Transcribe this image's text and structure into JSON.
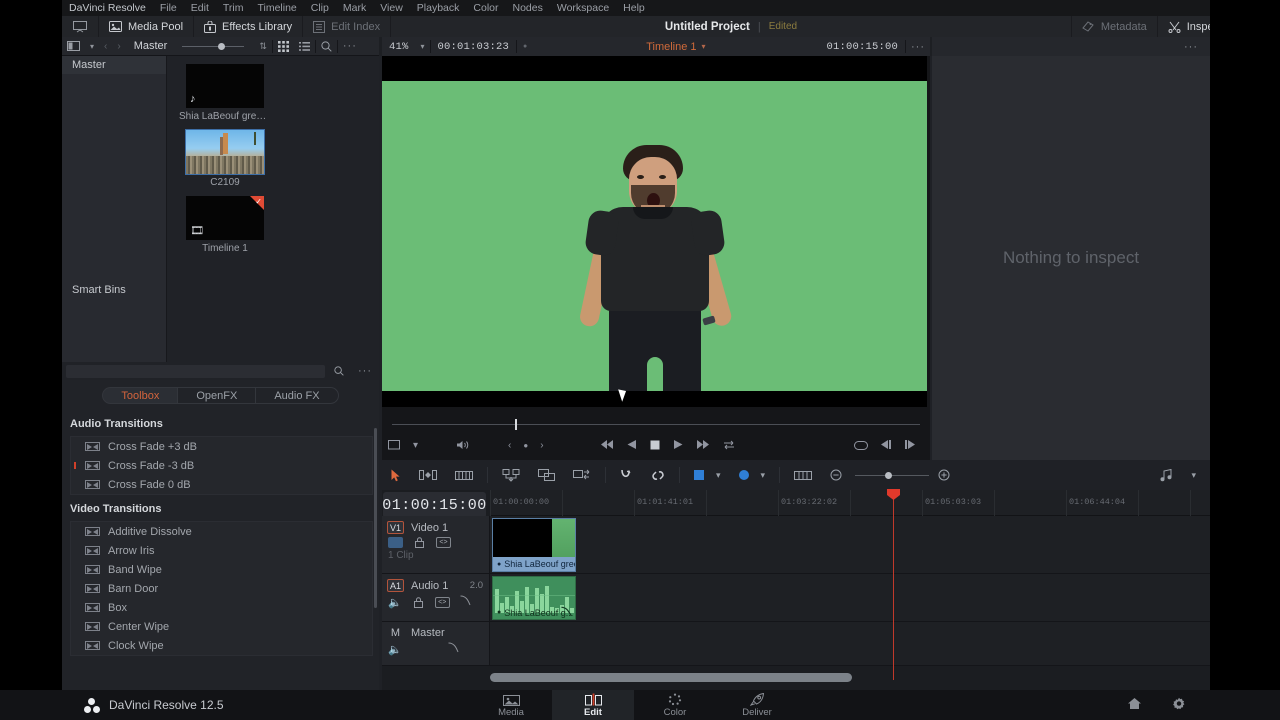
{
  "menu": {
    "app": "DaVinci Resolve",
    "items": [
      "File",
      "Edit",
      "Trim",
      "Timeline",
      "Clip",
      "Mark",
      "View",
      "Playback",
      "Color",
      "Nodes",
      "Workspace",
      "Help"
    ]
  },
  "toolbar": {
    "media_pool": "Media Pool",
    "effects_library": "Effects Library",
    "edit_index": "Edit Index",
    "project_title": "Untitled Project",
    "project_status": "Edited",
    "metadata": "Metadata",
    "inspector": "Inspector"
  },
  "pool_header": {
    "bin_name": "Master",
    "zoom": "41%"
  },
  "media_pool": {
    "bins": [
      "Master",
      "Smart Bins"
    ],
    "selected_bin": "Master",
    "items": [
      {
        "name": "Shia LaBeouf green s...",
        "icon": "music-note-icon",
        "kind": "audio"
      },
      {
        "name": "C2109",
        "icon": "thumbnail-icon",
        "kind": "video"
      },
      {
        "name": "Timeline 1",
        "icon": "film-strip-icon",
        "kind": "timeline"
      }
    ]
  },
  "viewer": {
    "zoom": "41%",
    "timecode_left": "00:01:03:23",
    "timeline_name": "Timeline 1",
    "timecode_right": "01:00:15:00"
  },
  "inspector": {
    "empty_message": "Nothing to inspect"
  },
  "effects": {
    "tabs": [
      {
        "label": "Toolbox",
        "active": true
      },
      {
        "label": "OpenFX",
        "active": false
      },
      {
        "label": "Audio FX",
        "active": false
      }
    ],
    "sections": [
      {
        "title": "Audio Transitions",
        "items": [
          {
            "label": "Cross Fade +3 dB",
            "default": false
          },
          {
            "label": "Cross Fade -3 dB",
            "default": true
          },
          {
            "label": "Cross Fade 0 dB",
            "default": false
          }
        ]
      },
      {
        "title": "Video Transitions",
        "items": [
          {
            "label": "Additive Dissolve",
            "default": false
          },
          {
            "label": "Arrow Iris",
            "default": false
          },
          {
            "label": "Band Wipe",
            "default": false
          },
          {
            "label": "Barn Door",
            "default": false
          },
          {
            "label": "Box",
            "default": false
          },
          {
            "label": "Center Wipe",
            "default": false
          },
          {
            "label": "Clock Wipe",
            "default": false
          }
        ]
      }
    ]
  },
  "timeline": {
    "timecode": "01:00:15:00",
    "ruler_labels": [
      "01:00:00:00",
      "01:01:41:01",
      "01:03:22:02",
      "01:05:03:03",
      "01:06:44:04"
    ],
    "tracks": [
      {
        "badge": "V1",
        "name": "Video 1",
        "channels": "",
        "clip_count": "1 Clip",
        "kind": "video"
      },
      {
        "badge": "A1",
        "name": "Audio 1",
        "channels": "2.0",
        "clip_count": "",
        "kind": "audio"
      },
      {
        "badge": "M",
        "name": "Master",
        "channels": "",
        "clip_count": "",
        "kind": "master"
      }
    ],
    "clips": [
      {
        "track": "V1",
        "label": "Shia LaBeouf gree..."
      },
      {
        "track": "A1",
        "label": "Shia LaBeouf g..."
      }
    ]
  },
  "status": {
    "brand": "DaVinci Resolve 12.5"
  },
  "pages": [
    {
      "label": "Media",
      "icon": "media-page-icon",
      "active": false
    },
    {
      "label": "Edit",
      "icon": "edit-page-icon",
      "active": true
    },
    {
      "label": "Color",
      "icon": "color-page-icon",
      "active": false
    },
    {
      "label": "Deliver",
      "icon": "deliver-page-icon",
      "active": false
    }
  ],
  "colors": {
    "accent": "#d4643c",
    "playhead": "#c0392b",
    "audio_clip": "#3f8f5c",
    "video_clip_label": "#7fa3c9",
    "blue_marker": "#2f7fd6"
  }
}
